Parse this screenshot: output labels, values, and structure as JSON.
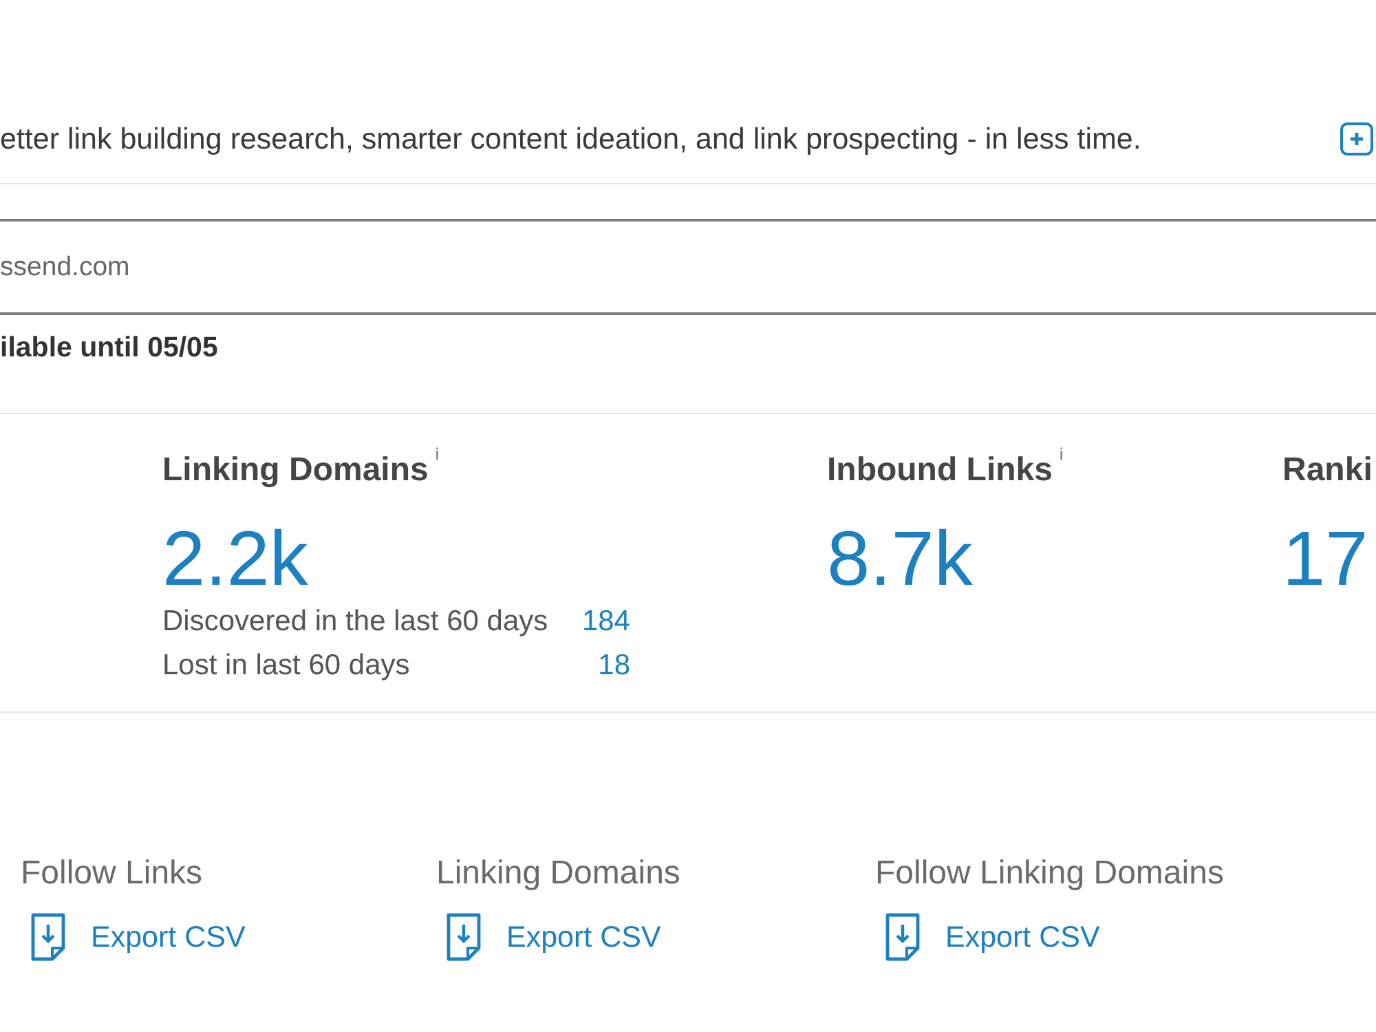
{
  "banner": {
    "text": "etter link building research, smarter content ideation, and link prospecting - in less time."
  },
  "domain_field": {
    "value": "ssend.com"
  },
  "availability": {
    "text": "ilable until 05/05"
  },
  "stats": [
    {
      "label": "Linking Domains",
      "info": "i",
      "value": "2.2k",
      "details": [
        {
          "label": "Discovered in the last 60 days",
          "value": "184"
        },
        {
          "label": "Lost in last 60 days",
          "value": "18"
        }
      ]
    },
    {
      "label": "Inbound Links",
      "info": "i",
      "value": "8.7k"
    },
    {
      "label": "Ranki",
      "value": "17"
    }
  ],
  "exports": [
    {
      "title": "Follow Links",
      "action": "Export CSV"
    },
    {
      "title": "Linking Domains",
      "action": "Export CSV"
    },
    {
      "title": "Follow Linking Domains",
      "action": "Export CSV"
    }
  ]
}
